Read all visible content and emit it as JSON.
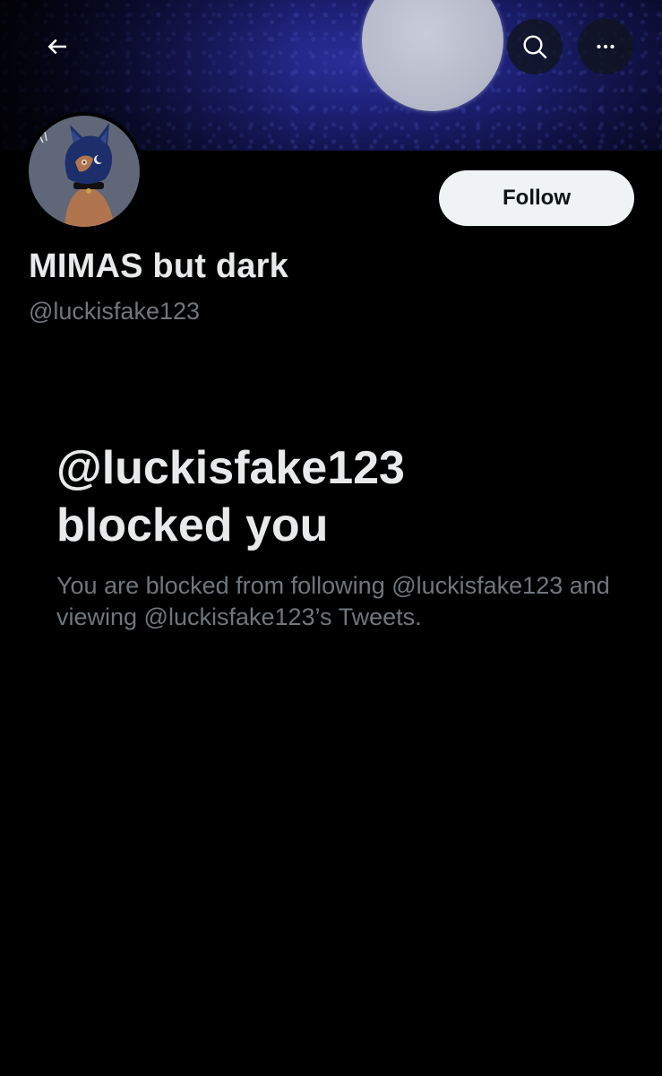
{
  "header": {
    "back_icon": "arrow-left-icon",
    "search_icon": "search-icon",
    "more_icon": "more-horizontal-icon"
  },
  "profile": {
    "display_name": "MIMAS but dark",
    "handle": "@luckisfake123",
    "follow_label": "Follow"
  },
  "blocked": {
    "title_line1": "@luckisfake123",
    "title_line2": "blocked you",
    "description": "You are blocked from following @luckisfake123 and viewing @luckisfake123’s Tweets."
  },
  "colors": {
    "background": "#000000",
    "primary_text": "#e7e9ea",
    "secondary_text": "#71767b",
    "follow_button_bg": "#eff3f4"
  }
}
